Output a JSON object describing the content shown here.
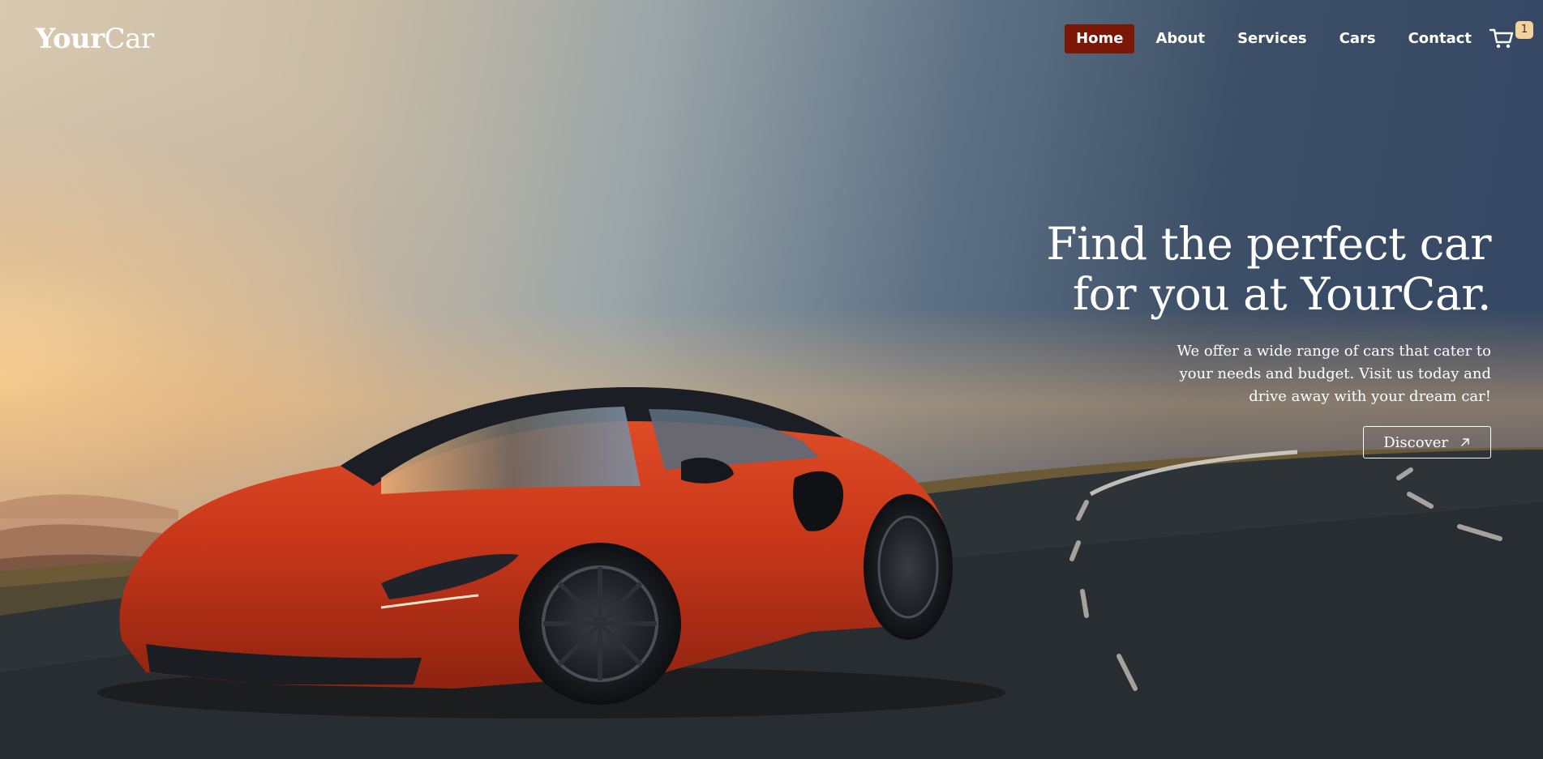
{
  "brand": {
    "name_bold": "Your",
    "name_light": "Car"
  },
  "nav": {
    "items": [
      {
        "label": "Home",
        "active": true
      },
      {
        "label": "About",
        "active": false
      },
      {
        "label": "Services",
        "active": false
      },
      {
        "label": "Cars",
        "active": false
      },
      {
        "label": "Contact",
        "active": false
      }
    ],
    "cart_count": "1"
  },
  "hero": {
    "title_line1": "Find the perfect car",
    "title_line2": "for you at YourCar.",
    "subtitle": "We offer a wide range of cars that cater to your needs and budget. Visit us today and drive away with your dream car!",
    "cta_label": "Discover",
    "cta_icon": "arrow-up-right-icon"
  },
  "colors": {
    "active_nav": "#7a1707",
    "badge": "#f2d29a",
    "car_body": "#c9371a"
  }
}
